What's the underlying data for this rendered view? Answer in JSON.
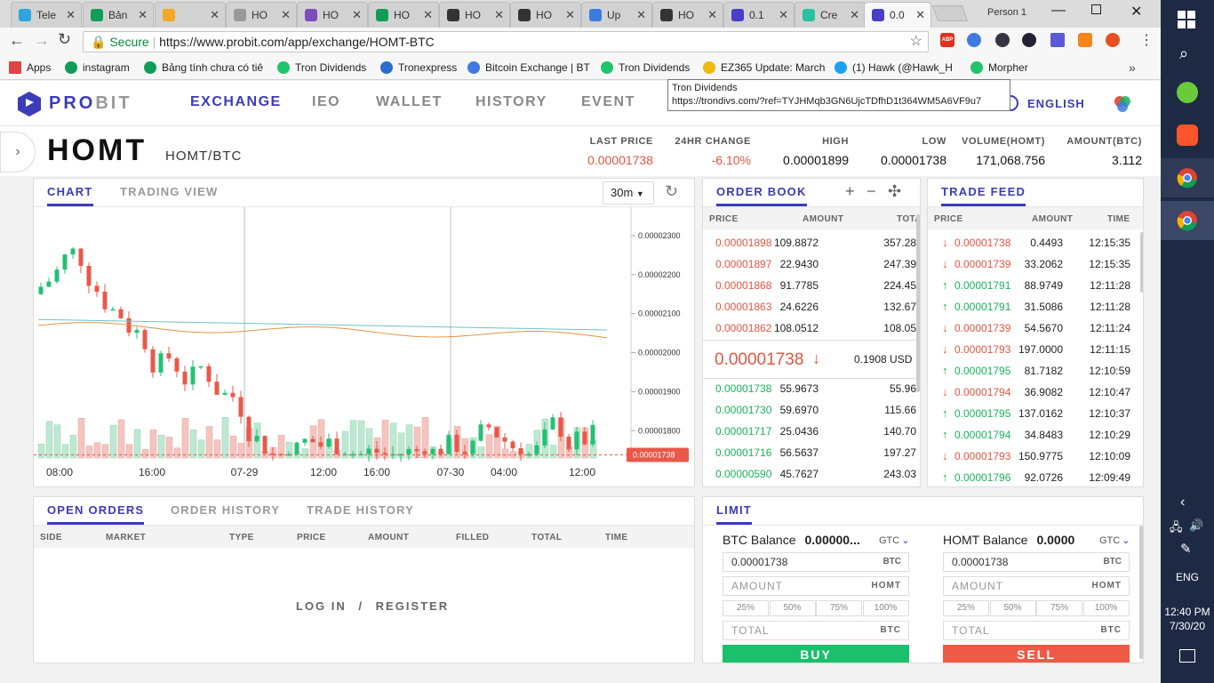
{
  "browser": {
    "tabs": [
      {
        "label": "Tele",
        "color": "#2ca5e0"
      },
      {
        "label": "Bản",
        "color": "#0f9d58"
      },
      {
        "label": "",
        "color": "#f5a623"
      },
      {
        "label": "HO",
        "color": "#999999"
      },
      {
        "label": "HO",
        "color": "#7c4dbb"
      },
      {
        "label": "HO",
        "color": "#0f9d58"
      },
      {
        "label": "HO",
        "color": "#333333"
      },
      {
        "label": "HO",
        "color": "#333333"
      },
      {
        "label": "Up",
        "color": "#3d7be0"
      },
      {
        "label": "HO",
        "color": "#333333"
      },
      {
        "label": "0.1",
        "color": "#4b3cc9"
      },
      {
        "label": "Cre",
        "color": "#29c2a0"
      },
      {
        "label": "0.0",
        "color": "#4b3cc9"
      }
    ],
    "profile": "Person 1",
    "secure_label": "Secure",
    "url": "https://www.probit.com/app/exchange/HOMT-BTC",
    "bookmarks": [
      {
        "label": "Apps",
        "color": "#d44"
      },
      {
        "label": "instagram",
        "color": "#0f9d58"
      },
      {
        "label": "Bảng tính chưa có tiê",
        "color": "#0f9d58"
      },
      {
        "label": "Tron Dividends",
        "color": "#1fc46b"
      },
      {
        "label": "Tronexpress",
        "color": "#2a6fc9"
      },
      {
        "label": "Bitcoin Exchange | BT",
        "color": "#3d7be0"
      },
      {
        "label": "Tron Dividends",
        "color": "#1fc46b"
      },
      {
        "label": "EZ365 Update: March",
        "color": "#f0b90b"
      },
      {
        "label": "(1) Hawk (@Hawk_H",
        "color": "#1da1f2"
      },
      {
        "label": "Morpher",
        "color": "#1fc46b"
      }
    ],
    "tooltip_title": "Tron Dividends",
    "tooltip_url": "https://trondivs.com/?ref=TYJHMqb3GN6UjcTDfhD1t364WM5A6VF9u7"
  },
  "nav": {
    "logo_pro": "PRO",
    "logo_bit": "BIT",
    "items": [
      "EXCHANGE",
      "IEO",
      "WALLET",
      "HISTORY",
      "EVENT"
    ],
    "language": "ENGLISH"
  },
  "ticker": {
    "symbol": "HOMT",
    "pair": "HOMT/BTC",
    "last_price_label": "LAST PRICE",
    "last_price": "0.00001738",
    "change_label": "24HR CHANGE",
    "change": "-6.10%",
    "high_label": "HIGH",
    "high": "0.00001899",
    "low_label": "LOW",
    "low": "0.00001738",
    "volume_label": "VOLUME(HOMT)",
    "volume": "171,068.756",
    "amount_label": "AMOUNT(BTC)",
    "amount": "3.112"
  },
  "chart_panel": {
    "tab_chart": "CHART",
    "tab_trading": "TRADING VIEW",
    "interval": "30m",
    "price_tag": "0.00001738"
  },
  "chart_data": {
    "type": "candlestick",
    "y_ticks": [
      "0.00002300",
      "0.00002200",
      "0.00002100",
      "0.00002000",
      "0.00001900",
      "0.00001800"
    ],
    "x_ticks": [
      "08:00",
      "16:00",
      "07-29",
      "12:00",
      "16:00",
      "07-30",
      "04:00",
      "12:00"
    ],
    "ylim": [
      1.73e-05,
      2.35e-05
    ],
    "last_price": 1.738e-05
  },
  "order_book": {
    "title": "ORDER BOOK",
    "headers": [
      "PRICE",
      "AMOUNT",
      "TOTA"
    ],
    "asks": [
      [
        "0.00001898",
        "109.8872",
        "357.28"
      ],
      [
        "0.00001897",
        "22.9430",
        "247.39"
      ],
      [
        "0.00001868",
        "91.7785",
        "224.45"
      ],
      [
        "0.00001863",
        "24.6226",
        "132.67"
      ],
      [
        "0.00001862",
        "108.0512",
        "108.05"
      ]
    ],
    "mid_price": "0.00001738",
    "mid_usd": "0.1908 USD",
    "bids": [
      [
        "0.00001738",
        "55.9673",
        "55.96"
      ],
      [
        "0.00001730",
        "59.6970",
        "115.66"
      ],
      [
        "0.00001717",
        "25.0436",
        "140.70"
      ],
      [
        "0.00001716",
        "56.5637",
        "197.27"
      ],
      [
        "0.00000590",
        "45.7627",
        "243.03"
      ]
    ]
  },
  "trade_feed": {
    "title": "TRADE FEED",
    "headers": [
      "PRICE",
      "AMOUNT",
      "TIME"
    ],
    "rows": [
      {
        "side": "sell",
        "price": "0.00001738",
        "amount": "0.4493",
        "time": "12:15:35"
      },
      {
        "side": "sell",
        "price": "0.00001739",
        "amount": "33.2062",
        "time": "12:15:35"
      },
      {
        "side": "buy",
        "price": "0.00001791",
        "amount": "88.9749",
        "time": "12:11:28"
      },
      {
        "side": "buy",
        "price": "0.00001791",
        "amount": "31.5086",
        "time": "12:11:28"
      },
      {
        "side": "sell",
        "price": "0.00001739",
        "amount": "54.5670",
        "time": "12:11:24"
      },
      {
        "side": "sell",
        "price": "0.00001793",
        "amount": "197.0000",
        "time": "12:11:15"
      },
      {
        "side": "buy",
        "price": "0.00001795",
        "amount": "81.7182",
        "time": "12:10:59"
      },
      {
        "side": "sell",
        "price": "0.00001794",
        "amount": "36.9082",
        "time": "12:10:47"
      },
      {
        "side": "buy",
        "price": "0.00001795",
        "amount": "137.0162",
        "time": "12:10:37"
      },
      {
        "side": "buy",
        "price": "0.00001794",
        "amount": "34.8483",
        "time": "12:10:29"
      },
      {
        "side": "sell",
        "price": "0.00001793",
        "amount": "150.9775",
        "time": "12:10:09"
      },
      {
        "side": "buy",
        "price": "0.00001796",
        "amount": "92.0726",
        "time": "12:09:49"
      }
    ]
  },
  "orders_panel": {
    "tabs": [
      "OPEN ORDERS",
      "ORDER HISTORY",
      "TRADE HISTORY"
    ],
    "headers": [
      "SIDE",
      "MARKET",
      "TYPE",
      "PRICE",
      "AMOUNT",
      "FILLED",
      "TOTAL",
      "TIME"
    ],
    "login": "LOG IN",
    "sep": "/",
    "register": "REGISTER"
  },
  "limit_panel": {
    "title": "LIMIT",
    "buy": {
      "balance_label": "BTC Balance",
      "balance": "0.00000...",
      "unit": "GTC",
      "price": "0.00001738",
      "price_unit": "BTC",
      "amount_ph": "AMOUNT",
      "amount_unit": "HOMT",
      "pcts": [
        "25%",
        "50%",
        "75%",
        "100%"
      ],
      "total_ph": "TOTAL",
      "total_unit": "BTC",
      "button": "BUY"
    },
    "sell": {
      "balance_label": "HOMT Balance",
      "balance": "0.0000",
      "unit": "GTC",
      "price": "0.00001738",
      "price_unit": "BTC",
      "amount_ph": "AMOUNT",
      "amount_unit": "HOMT",
      "pcts": [
        "25%",
        "50%",
        "75%",
        "100%"
      ],
      "total_ph": "TOTAL",
      "total_unit": "BTC",
      "button": "SELL"
    }
  },
  "taskbar": {
    "lang": "ENG",
    "time": "12:40 PM",
    "date": "7/30/20"
  }
}
